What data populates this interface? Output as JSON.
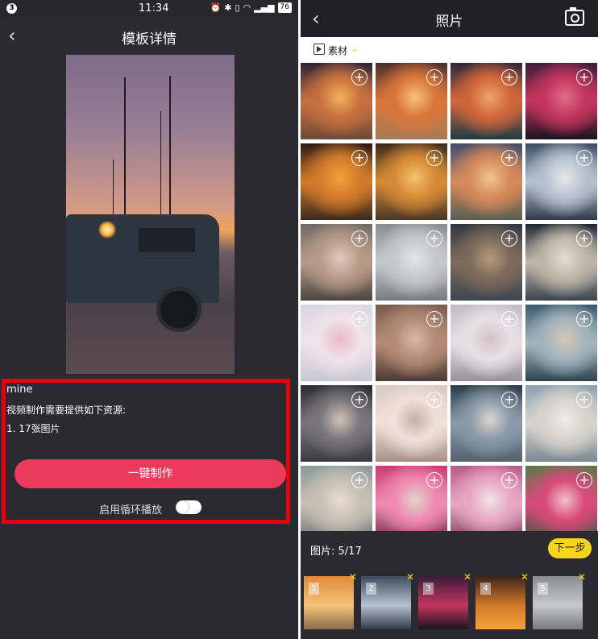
{
  "left": {
    "status": {
      "badge": "3",
      "time": "11:34",
      "battery": "76"
    },
    "title": "模板详情",
    "template_name": "mine",
    "requirement_text": "视频制作需要提供如下资源:",
    "requirement_item": "1. 17张图片",
    "make_button": "一键制作",
    "loop_label": "启用循环播放",
    "loop_enabled": false
  },
  "right": {
    "title": "照片",
    "source_label": "素材",
    "photos": [
      {
        "colors": [
          "#2b2236",
          "#c7703f",
          "#f4b25a",
          "#6e4a37"
        ]
      },
      {
        "colors": [
          "#4a2e2a",
          "#d9763a",
          "#f6c27a",
          "#a87a57"
        ]
      },
      {
        "colors": [
          "#2d2738",
          "#d1663c",
          "#f0a46a",
          "#1f3b45"
        ]
      },
      {
        "colors": [
          "#3a1d38",
          "#c3355e",
          "#e06d87",
          "#1a1320"
        ]
      },
      {
        "colors": [
          "#2b1a14",
          "#d27a2a",
          "#f2a23b",
          "#3b2a1e"
        ]
      },
      {
        "colors": [
          "#3a2a18",
          "#d68a36",
          "#f5c26b",
          "#4a3626"
        ]
      },
      {
        "colors": [
          "#404c6e",
          "#d58a5a",
          "#f1c48d",
          "#5a5d55"
        ]
      },
      {
        "colors": [
          "#3c4b62",
          "#b6c2cf",
          "#e8e8ea",
          "#2f3a4c"
        ]
      },
      {
        "colors": [
          "#6f6a66",
          "#b89a88",
          "#e0cbbd",
          "#4a4542"
        ]
      },
      {
        "colors": [
          "#8a8c91",
          "#c6c8cc",
          "#e6e6e8",
          "#787a80"
        ]
      },
      {
        "colors": [
          "#2f3640",
          "#7d6a5c",
          "#b89a7d",
          "#3d4550"
        ]
      },
      {
        "colors": [
          "#1f2a36",
          "#bfb6a8",
          "#e4ddd2",
          "#3a4450"
        ]
      },
      {
        "colors": [
          "#d8d6e4",
          "#f0e2e8",
          "#e9b9c6",
          "#c7c7d4"
        ]
      },
      {
        "colors": [
          "#7a5a4e",
          "#b48c76",
          "#d7b9a4",
          "#4e3a34"
        ]
      },
      {
        "colors": [
          "#c0bcc4",
          "#e8e0e4",
          "#d3c2c7",
          "#9a8f99"
        ]
      },
      {
        "colors": [
          "#3a5a6e",
          "#a4b4bc",
          "#d8c8b8",
          "#2d4352"
        ]
      },
      {
        "colors": [
          "#2a2a30",
          "#78767a",
          "#d2c2ba",
          "#3b3b42"
        ]
      },
      {
        "colors": [
          "#d8c8c4",
          "#f0e0d8",
          "#c8b0a4",
          "#a89088"
        ]
      },
      {
        "colors": [
          "#2c3a4a",
          "#8a9aa8",
          "#dcd6d0",
          "#556270"
        ]
      },
      {
        "colors": [
          "#8aa0b0",
          "#d8d4cc",
          "#f0ece6",
          "#7a8894"
        ]
      },
      {
        "colors": [
          "#8a9a9c",
          "#c8c0b4",
          "#e8dcd0",
          "#6a7478"
        ]
      },
      {
        "colors": [
          "#c83c72",
          "#f08ab0",
          "#e0d4cc",
          "#6a2a40"
        ]
      },
      {
        "colors": [
          "#b85a8a",
          "#e8a8c4",
          "#f0e4e4",
          "#7a3a5a"
        ]
      },
      {
        "colors": [
          "#5a7a4a",
          "#d84a7a",
          "#f0c0c8",
          "#3a5a3a"
        ]
      }
    ],
    "selected_label": "图片:",
    "selected_count": "5/17",
    "next_button": "下一步",
    "thumbs": [
      {
        "index": "1",
        "colors": [
          "#e08a3a",
          "#f6c27a",
          "#8a6a4a"
        ]
      },
      {
        "index": "2",
        "colors": [
          "#3c4b62",
          "#b6c2cf",
          "#2f3a4c"
        ]
      },
      {
        "index": "3",
        "colors": [
          "#3a1d38",
          "#c3355e",
          "#1a1320"
        ]
      },
      {
        "index": "4",
        "colors": [
          "#3a2418",
          "#d27a2a",
          "#f2a23b"
        ]
      },
      {
        "index": "5",
        "colors": [
          "#8a8c91",
          "#c6c8cc",
          "#787a80"
        ]
      }
    ]
  }
}
